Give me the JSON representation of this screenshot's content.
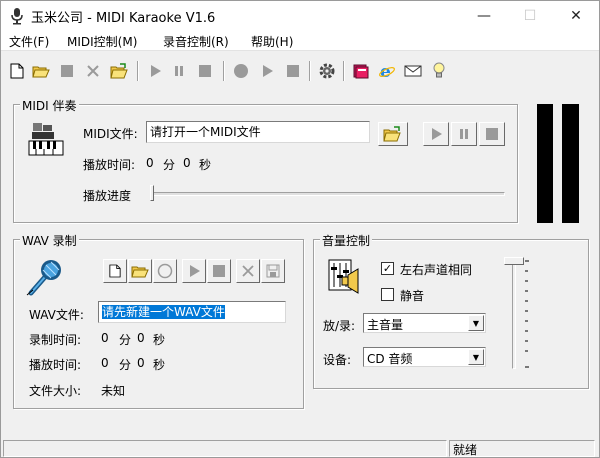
{
  "window": {
    "title": "玉米公司 - MIDI Karaoke V1.6",
    "minimize": "—",
    "maximize": "☐",
    "close": "✕"
  },
  "menu": [
    "文件(F)",
    "MIDI控制(M)",
    "录音控制(R)",
    "帮助(H)"
  ],
  "midi": {
    "group_title": "MIDI 伴奏",
    "file_label": "MIDI文件:",
    "file_value": "请打开一个MIDI文件",
    "time_label": "播放时间:",
    "time_min": "0",
    "min_unit": "分",
    "time_sec": "0",
    "sec_unit": "秒",
    "progress_label": "播放进度",
    "progress": 0
  },
  "wav": {
    "group_title": "WAV 录制",
    "file_label": "WAV文件:",
    "file_value": "请先新建一个WAV文件",
    "rec_label": "录制时间:",
    "rec_min": "0",
    "rec_sec": "0",
    "play_label": "播放时间:",
    "play_min": "0",
    "play_sec": "0",
    "min_unit": "分",
    "sec_unit": "秒",
    "size_label": "文件大小:",
    "size_value": "未知"
  },
  "volume": {
    "group_title": "音量控制",
    "same_channel_label": "左右声道相同",
    "same_channel_checked": true,
    "mute_label": "静音",
    "mute_checked": false,
    "playrec_label": "放/录:",
    "playrec_value": "主音量",
    "device_label": "设备:",
    "device_value": "CD 音频"
  },
  "status": {
    "text": "就绪"
  },
  "colors": {
    "accent": "#0078d7",
    "panel": "#f0f0f0",
    "meter": "#000000"
  }
}
